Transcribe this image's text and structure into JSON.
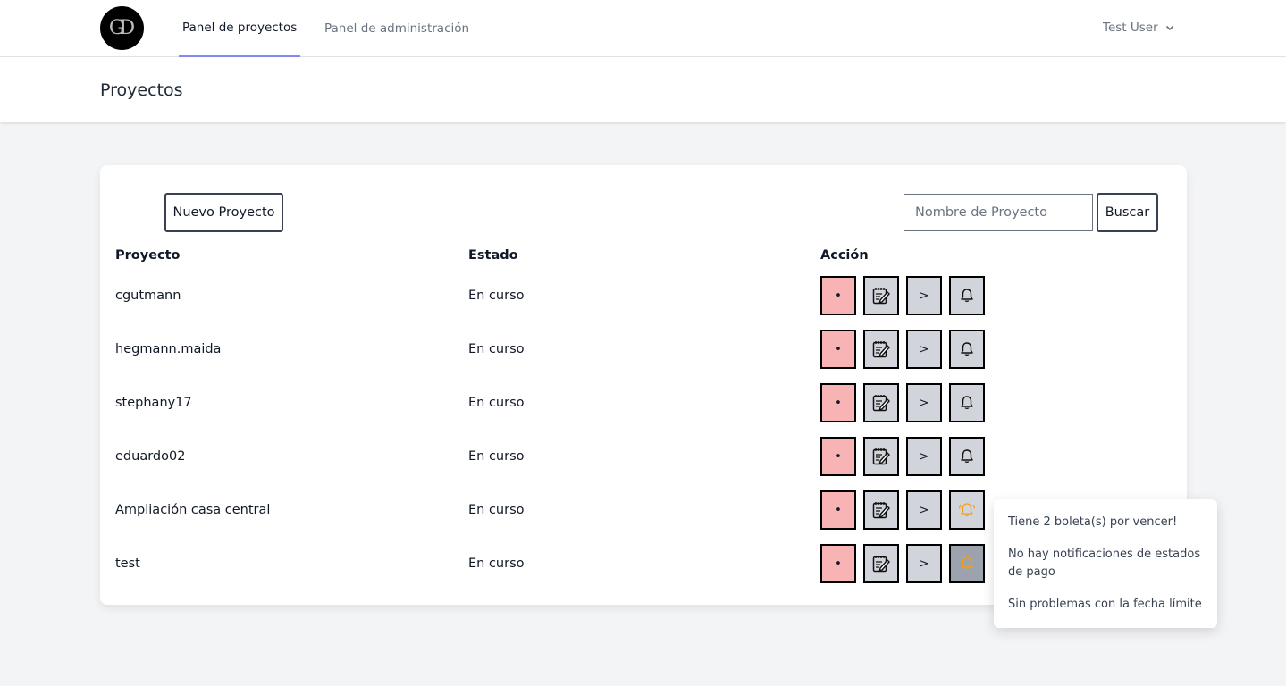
{
  "nav": {
    "logo_text": "GD",
    "links": [
      "Panel de proyectos",
      "Panel de administración"
    ],
    "user": "Test User"
  },
  "header": {
    "title": "Proyectos"
  },
  "toolbar": {
    "new_label": "Nuevo Proyecto",
    "search_placeholder": "Nombre de Proyecto",
    "search_label": "Buscar"
  },
  "table": {
    "headers": [
      "Proyecto",
      "Estado",
      "Acción"
    ],
    "rows": [
      {
        "project": "cgutmann",
        "status": "En curso",
        "bell": "normal"
      },
      {
        "project": "hegmann.maida",
        "status": "En curso",
        "bell": "normal"
      },
      {
        "project": "stephany17",
        "status": "En curso",
        "bell": "normal"
      },
      {
        "project": "eduardo02",
        "status": "En curso",
        "bell": "normal"
      },
      {
        "project": "Ampliación casa central",
        "status": "En curso",
        "bell": "alert"
      },
      {
        "project": "test",
        "status": "En curso",
        "bell": "alert-active"
      }
    ],
    "action_labels": {
      "dot": "•",
      "next": ">"
    }
  },
  "popup": {
    "items": [
      "Tiene 2 boleta(s) por vencer!",
      "No hay notificaciones de estados de pago",
      "Sin problemas con la fecha límite"
    ]
  },
  "colors": {
    "accent": "#818cf8",
    "delete_bg": "#f8b4b4",
    "action_bg": "#d1d5db",
    "alert_bell": "#f59e0b"
  }
}
